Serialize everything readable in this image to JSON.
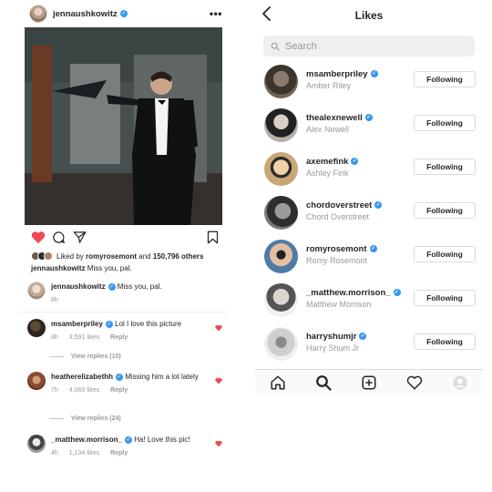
{
  "post": {
    "username": "jennaushkowitz",
    "more_label": "•••",
    "liked_by_prefix": "Liked by",
    "liked_by_user": "romyrosemont",
    "liked_by_and": "and",
    "liked_by_others": "150,796 others",
    "caption_user": "jennaushkowitz",
    "caption_text": "Miss you, pal.",
    "comments": [
      {
        "user": "jennaushkowitz",
        "text": "Miss you, pal.",
        "time": "8h",
        "likes": "",
        "reply": ""
      },
      {
        "user": "msamberpriley",
        "text": "Lol I love this picture",
        "time": "8h",
        "likes": "3,591 likes",
        "reply": "Reply",
        "view_replies": "View replies (10)"
      },
      {
        "user": "heatherelizabethh",
        "text": "Missing him a lot lately",
        "time": "7h",
        "likes": "4,069 likes",
        "reply": "Reply",
        "view_replies": "View replies (24)"
      },
      {
        "user": "_matthew.morrison_",
        "text": "Ha! Love this pic!",
        "time": "4h",
        "likes": "1,134 likes",
        "reply": "Reply"
      }
    ]
  },
  "likes": {
    "title": "Likes",
    "search_placeholder": "Search",
    "follow_label": "Following",
    "users": [
      {
        "username": "msamberpriley",
        "full_name": "Amber Riley"
      },
      {
        "username": "thealexnewell",
        "full_name": "Alex Newell"
      },
      {
        "username": "axemefink",
        "full_name": "Ashley Fink"
      },
      {
        "username": "chordoverstreet",
        "full_name": "Chord Overstreet"
      },
      {
        "username": "romyrosemont",
        "full_name": "Romy Rosemont"
      },
      {
        "username": "_matthew.morrison_",
        "full_name": "Matthew Morrison"
      },
      {
        "username": "harryshumjr",
        "full_name": "Harry Shum Jr"
      }
    ]
  },
  "colors": {
    "heart_red": "#ed4956",
    "verified_blue": "#3897f0",
    "muted_text": "#999999"
  },
  "icons": [
    "heart-icon",
    "comment-icon",
    "share-icon",
    "bookmark-icon",
    "back-icon",
    "search-icon",
    "home-icon",
    "add-icon",
    "activity-icon",
    "profile-icon",
    "verified-icon"
  ]
}
